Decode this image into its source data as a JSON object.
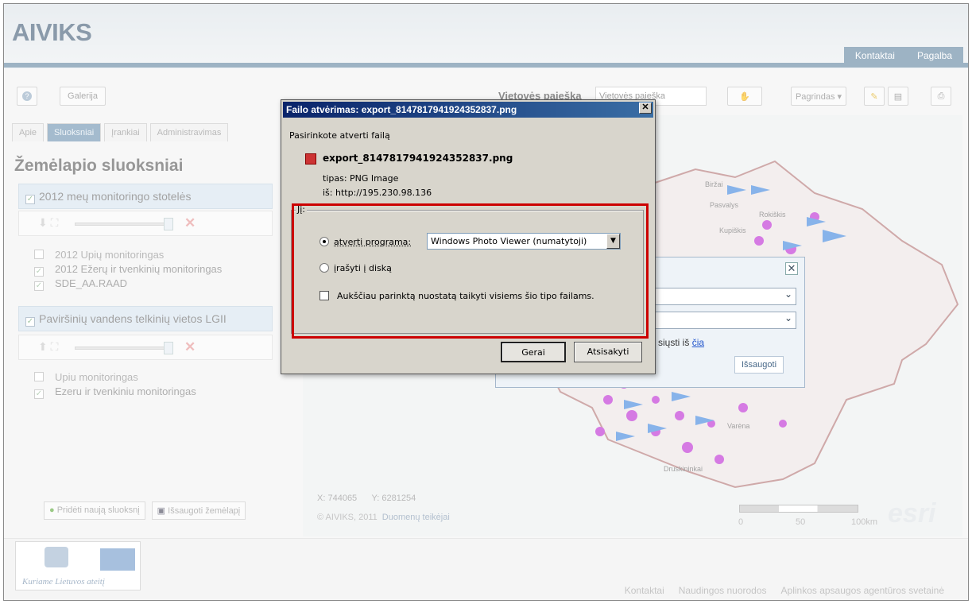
{
  "app": {
    "title": "AIVIKS"
  },
  "top_links": [
    "Kontaktai",
    "Pagalba"
  ],
  "toolbar": {
    "galerija": "Galerija",
    "search_label": "Vietovės paieška",
    "search_placeholder": "Vietovės paieška",
    "pagrindas": "Pagrindas ▾"
  },
  "left_panel": {
    "tabs": [
      "Apie",
      "Sluoksniai",
      "Įrankiai",
      "Administravimas"
    ],
    "title": "Žemėlapio sluoksniai",
    "group1": {
      "label": "2012 meų monitoringo stotelės",
      "layers": [
        {
          "label": "2012 Upių monitoringas",
          "checked": false
        },
        {
          "label": "2012 Ežerų ir tvenkinių monitoringas",
          "checked": true
        },
        {
          "label": "SDE_AA.RAAD",
          "checked": true
        }
      ]
    },
    "group2": {
      "label": "Paviršinių vandens telkinių vietos LGII",
      "layers": [
        {
          "label": "Upiu monitoringas",
          "checked": false
        },
        {
          "label": "Ezeru ir tvenkiniu monitoringas",
          "checked": true
        }
      ]
    },
    "add_layer": "Pridėti naują sluoksnį",
    "save_map": "Išsaugoti žemėlapį"
  },
  "map": {
    "x_label": "X:",
    "x_value": "744065",
    "y_label": "Y:",
    "y_value": "6281254",
    "copyright": "© AIVIKS, 2011",
    "data_providers": "Duomenų teikėjai",
    "scale": [
      "0",
      "50",
      "100km"
    ],
    "esri": "esri",
    "place_names": [
      "Biržai",
      "Pasvalys",
      "Rokiškis",
      "Kupiškis",
      "Druskininkai",
      "Varėna"
    ]
  },
  "secondary_dialog": {
    "download_text": "siųsti iš",
    "download_link": "čia",
    "save": "Išsaugoti",
    "close": "✕"
  },
  "dialog": {
    "title": "Failo atvėrimas: export_8147817941924352837.png",
    "close": "✕",
    "intro": "Pasirinkote atverti failą",
    "filename": "export_8147817941924352837.png",
    "type_label": "tipas:",
    "type_value": "PNG Image",
    "from_label": "iš:",
    "from_value": "http://195.230.98.136",
    "group_label": "Jį:",
    "open_with": "atverti programa:",
    "program": "Windows Photo Viewer (numatytoji)",
    "save_to_disk": "įrašyti į diską",
    "always": "Aukščiau parinktą nuostatą taikyti visiems šio tipo failams.",
    "ok": "Gerai",
    "cancel": "Atsisakyti"
  },
  "footer": {
    "slogan": "Kuriame Lietuvos ateitį",
    "links": [
      "Kontaktai",
      "Naudingos nuorodos",
      "Aplinkos apsaugos agentūros svetainė"
    ]
  },
  "colors": {
    "accent": "#6f8fa9",
    "dialog_title": "#0a246a",
    "highlight": "#cc0000",
    "map_point": "#c23cd6",
    "map_flag": "#4f8fe0"
  }
}
